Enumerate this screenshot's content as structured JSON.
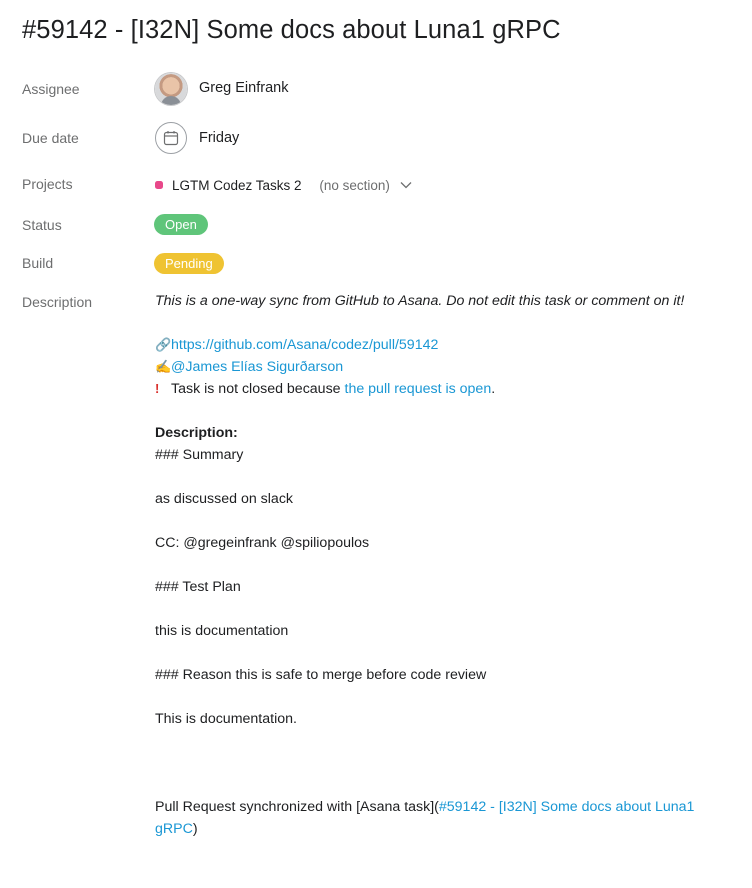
{
  "task": {
    "title": "#59142 - [I32N] Some docs about Luna1 gRPC"
  },
  "fields": {
    "assignee_label": "Assignee",
    "assignee_value": "Greg Einfrank",
    "due_label": "Due date",
    "due_value": "Friday",
    "projects_label": "Projects",
    "project_name": "LGTM Codez Tasks 2",
    "project_section": "(no section)",
    "status_label": "Status",
    "status_value": "Open",
    "build_label": "Build",
    "build_value": "Pending",
    "description_label": "Description"
  },
  "colors": {
    "open": "#5fc57a",
    "pending": "#efc332",
    "project_dot": "#e8488a",
    "link": "#1a97d4"
  },
  "icons": {
    "calendar": "calendar-icon",
    "chevron": "chevron-down-icon",
    "link": "link-emoji",
    "writing": "writing-hand-emoji",
    "alert": "exclamation-emoji"
  },
  "description": {
    "intro": "This is a one-way sync from GitHub to Asana. Do not edit this task or comment on it!",
    "pr_link": "https://github.com/Asana/codez/pull/59142",
    "author": "@James Elías Sigurðarson",
    "not_closed_prefix": "Task is not closed because ",
    "not_closed_link": "the pull request is open",
    "not_closed_suffix": ".",
    "heading": "Description:",
    "lines": {
      "summary": "### Summary",
      "slack": "as discussed on slack",
      "cc": "CC: @gregeinfrank @spiliopoulos",
      "test_plan": "### Test Plan",
      "doc1": "this is documentation",
      "reason": "### Reason this is safe to merge before code review",
      "doc2": "This is documentation."
    },
    "sync_prefix": "Pull Request synchronized with [Asana task](",
    "sync_link_1": "#59142 - [I32N] Some docs about Luna1",
    "sync_link_2": "gRPC",
    "sync_suffix": ")"
  }
}
